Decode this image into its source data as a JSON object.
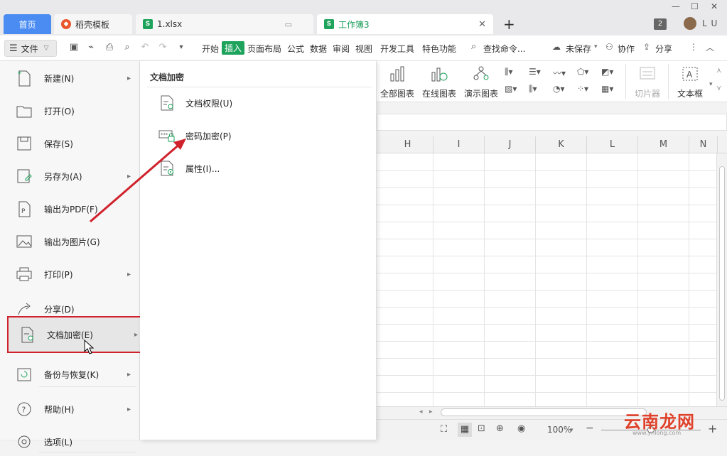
{
  "tabs": {
    "home": "首页",
    "template": "稻壳模板",
    "file1": "1.xlsx",
    "active": "工作簿3",
    "new_tab": "+"
  },
  "titlebar": {
    "badge": "2",
    "user": "L U"
  },
  "menubar": {
    "file": "文件",
    "items": [
      "开始",
      "插入",
      "页面布局",
      "公式",
      "数据",
      "审阅",
      "视图",
      "开发工具",
      "特色功能"
    ],
    "search": "查找命令...",
    "unsaved": "未保存",
    "collab": "协作",
    "share": "分享"
  },
  "ribbon": {
    "all_charts": "全部图表",
    "online_charts": "在线图表",
    "demo_charts": "演示图表",
    "slicer": "切片器",
    "textbox": "文本框"
  },
  "grid": {
    "columns": [
      "H",
      "I",
      "J",
      "K",
      "L",
      "M",
      "N"
    ]
  },
  "status": {
    "zoom": "100%"
  },
  "file_menu": {
    "items": [
      {
        "label": "新建(N)",
        "icon": "new-file-icon",
        "arrow": true
      },
      {
        "label": "打开(O)",
        "icon": "folder-open-icon",
        "arrow": false
      },
      {
        "label": "保存(S)",
        "icon": "save-icon",
        "arrow": false
      },
      {
        "label": "另存为(A)",
        "icon": "save-as-icon",
        "arrow": true
      },
      {
        "label": "输出为PDF(F)",
        "icon": "pdf-export-icon",
        "arrow": false
      },
      {
        "label": "输出为图片(G)",
        "icon": "image-export-icon",
        "arrow": false
      },
      {
        "label": "打印(P)",
        "icon": "print-icon",
        "arrow": true
      },
      {
        "label": "分享(D)",
        "icon": "share-icon",
        "arrow": false
      },
      {
        "label": "文档加密(E)",
        "icon": "encrypt-doc-icon",
        "arrow": true
      },
      {
        "label": "备份与恢复(K)",
        "icon": "backup-icon",
        "arrow": true
      },
      {
        "label": "帮助(H)",
        "icon": "help-icon",
        "arrow": true
      },
      {
        "label": "选项(L)",
        "icon": "options-icon",
        "arrow": false
      }
    ]
  },
  "submenu": {
    "title": "文档加密",
    "items": [
      {
        "label": "文档权限(U)",
        "icon": "doc-permission-icon"
      },
      {
        "label": "密码加密(P)",
        "icon": "password-encrypt-icon"
      },
      {
        "label": "属性(I)...",
        "icon": "properties-icon"
      }
    ]
  },
  "watermark": {
    "text": "云南龙网",
    "url": "www.ynlong.com"
  },
  "colors": {
    "accent_green": "#1ea35c",
    "home_tab": "#4a8cf2",
    "highlight_box": "#d0222c",
    "arrow": "#d0222c"
  }
}
